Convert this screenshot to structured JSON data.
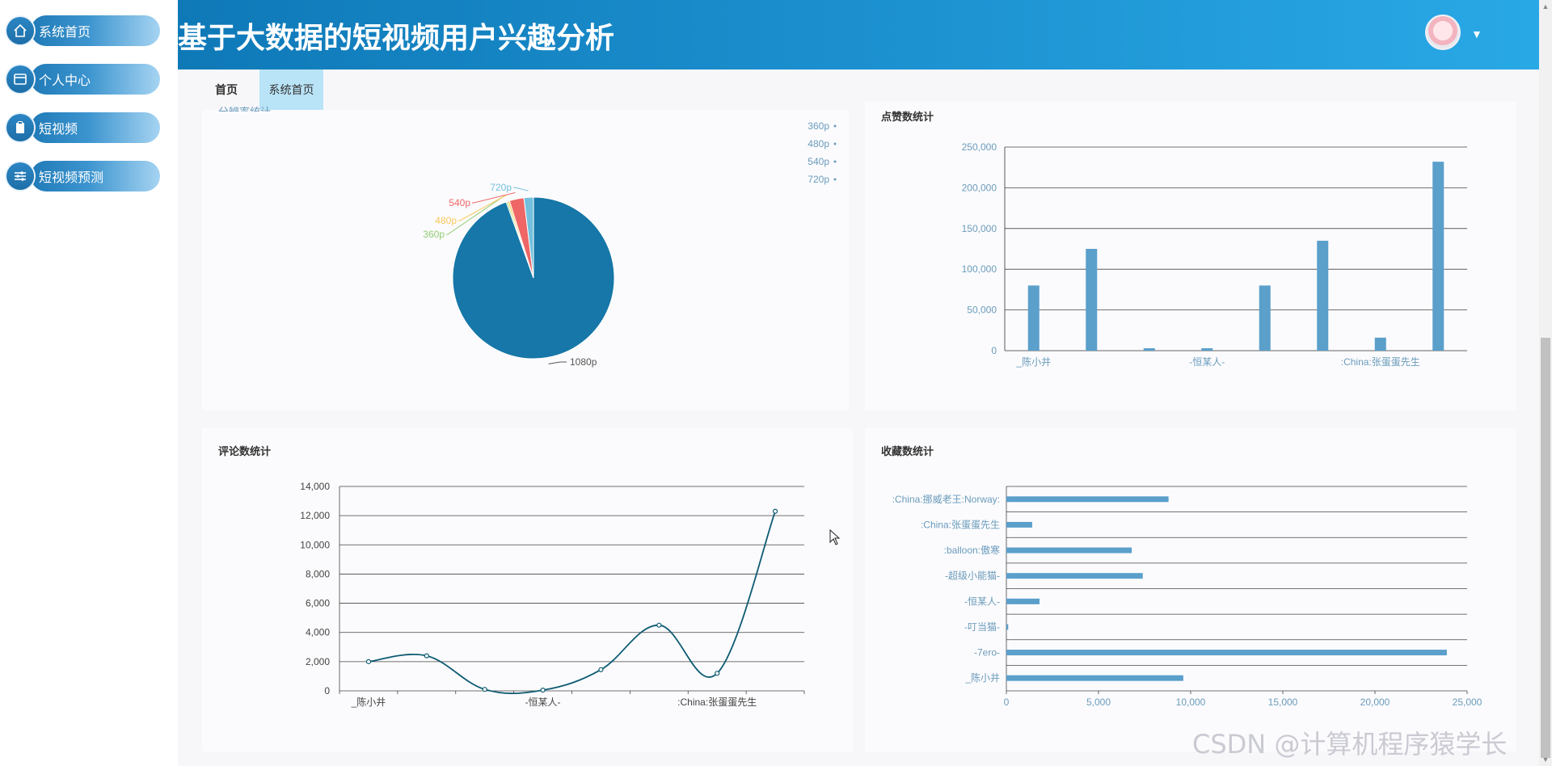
{
  "sidebar": {
    "items": [
      {
        "label": "系统首页",
        "icon": "home-icon"
      },
      {
        "label": "个人中心",
        "icon": "card-icon"
      },
      {
        "label": "短视频",
        "icon": "clipboard-icon"
      },
      {
        "label": "短视频预测",
        "icon": "sliders-icon"
      }
    ]
  },
  "header": {
    "title": "基于大数据的短视频用户兴趣分析"
  },
  "tabs": {
    "home": "首页",
    "system_home": "系统首页"
  },
  "cards": {
    "pie_title_partial": "分辨率统计",
    "likes_title": "点赞数统计",
    "comments_title": "评论数统计",
    "favorites_title": "收藏数统计"
  },
  "watermark": "CSDN @计算机程序猿学长",
  "chart_data": [
    {
      "type": "pie",
      "title": "分辨率统计",
      "categories": [
        "1080p",
        "360p",
        "480p",
        "540p",
        "720p"
      ],
      "values": [
        94.5,
        0.3,
        0.4,
        2.9,
        1.9
      ],
      "legend": [
        "1080p",
        "360p",
        "480p",
        "540p",
        "720p"
      ],
      "legend_placement": "top-right",
      "colors": [
        "#1677a8",
        "#91cc75",
        "#fac858",
        "#ee6666",
        "#73c0de"
      ]
    },
    {
      "type": "bar",
      "title": "点赞数统计",
      "categories": [
        "_陈小井",
        "",
        "",
        "-恒某人-",
        "",
        "",
        ":China:张蛋蛋先生",
        ""
      ],
      "values": [
        80000,
        125000,
        3000,
        3000,
        80000,
        135000,
        16000,
        232000
      ],
      "ylim": [
        0,
        250000
      ],
      "yticks": [
        "0",
        "50,000",
        "100,000",
        "150,000",
        "200,000",
        "250,000"
      ],
      "xticklabels": [
        "_陈小井",
        "-恒某人-",
        ":China:张蛋蛋先生"
      ],
      "color": "#5b9fcb"
    },
    {
      "type": "line",
      "title": "评论数统计",
      "categories": [
        "_陈小井",
        "",
        "",
        "-恒某人-",
        "",
        "",
        ":China:张蛋蛋先生",
        ""
      ],
      "values": [
        2000,
        2400,
        100,
        50,
        1450,
        4500,
        1200,
        12300
      ],
      "ylim": [
        0,
        14000
      ],
      "yticks": [
        "0",
        "2,000",
        "4,000",
        "6,000",
        "8,000",
        "10,000",
        "12,000",
        "14,000"
      ],
      "xticklabels": [
        "_陈小井",
        "-恒某人-",
        ":China:张蛋蛋先生"
      ],
      "color": "#0e5b73"
    },
    {
      "type": "bar",
      "orientation": "horizontal",
      "title": "收藏数统计",
      "categories": [
        ":China:挪威老王:Norway:",
        ":China:张蛋蛋先生",
        ":balloon:傲寒",
        "-超级小能猫-",
        "-恒某人-",
        "-叮当猫-",
        "-7ero-",
        "_陈小井"
      ],
      "values": [
        8800,
        1400,
        6800,
        7400,
        1800,
        100,
        23900,
        9600
      ],
      "xlim": [
        0,
        25000
      ],
      "xticks": [
        "0",
        "5,000",
        "10,000",
        "15,000",
        "20,000",
        "25,000"
      ],
      "color": "#5b9fcb"
    }
  ]
}
